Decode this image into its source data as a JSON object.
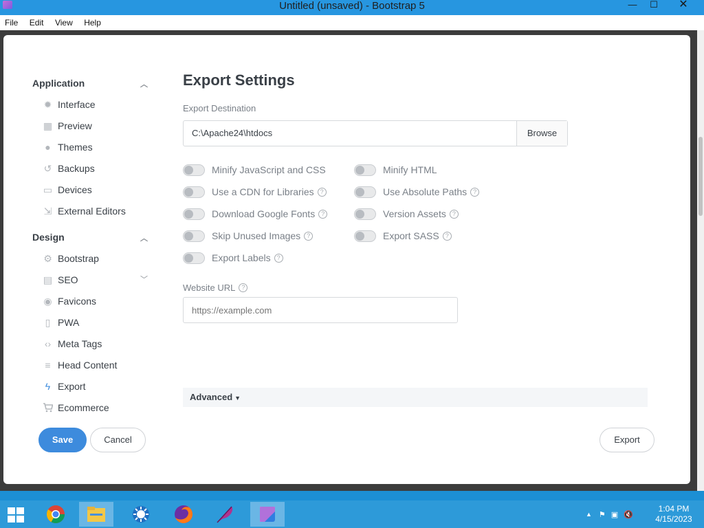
{
  "window": {
    "title": "Untitled (unsaved) - Bootstrap 5",
    "min_glyph": "—",
    "max_glyph": "☐",
    "close_glyph": "✕"
  },
  "menu": [
    "File",
    "Edit",
    "View",
    "Help"
  ],
  "sidebar": {
    "sections": [
      {
        "title": "Application",
        "items": [
          {
            "label": "Interface",
            "icon": "sun-icon",
            "glyph": "✹"
          },
          {
            "label": "Preview",
            "icon": "film-icon",
            "glyph": "▦"
          },
          {
            "label": "Themes",
            "icon": "palette-icon",
            "glyph": "●"
          },
          {
            "label": "Backups",
            "icon": "history-icon",
            "glyph": "↺"
          },
          {
            "label": "Devices",
            "icon": "laptop-icon",
            "glyph": "▭"
          },
          {
            "label": "External Editors",
            "icon": "external-link-icon",
            "glyph": "⇲"
          }
        ]
      },
      {
        "title": "Design",
        "items": [
          {
            "label": "Bootstrap",
            "icon": "gear-icon",
            "glyph": "⚙"
          },
          {
            "label": "SEO",
            "icon": "chart-icon",
            "glyph": "▤"
          },
          {
            "label": "Favicons",
            "icon": "circle-icon",
            "glyph": "◉"
          },
          {
            "label": "PWA",
            "icon": "phone-icon",
            "glyph": "▯"
          },
          {
            "label": "Meta Tags",
            "icon": "code-icon",
            "glyph": "‹›"
          },
          {
            "label": "Head Content",
            "icon": "lines-icon",
            "glyph": "≡"
          },
          {
            "label": "Export",
            "icon": "lightning-icon",
            "glyph": "ϟ"
          },
          {
            "label": "Ecommerce",
            "icon": "cart-icon",
            "glyph": "🛒"
          }
        ]
      }
    ]
  },
  "main": {
    "title": "Export Settings",
    "export_destination_label": "Export Destination",
    "export_destination_value": "C:\\Apache24\\htdocs",
    "browse_label": "Browse",
    "toggles": [
      {
        "label": "Minify JavaScript and CSS",
        "help": false,
        "on": false
      },
      {
        "label": "Minify HTML",
        "help": false,
        "on": false
      },
      {
        "label": "Use a CDN for Libraries",
        "help": true,
        "on": false
      },
      {
        "label": "Use Absolute Paths",
        "help": true,
        "on": false
      },
      {
        "label": "Download Google Fonts",
        "help": true,
        "on": false
      },
      {
        "label": "Version Assets",
        "help": true,
        "on": false
      },
      {
        "label": "Skip Unused Images",
        "help": true,
        "on": false
      },
      {
        "label": "Export SASS",
        "help": true,
        "on": false
      },
      {
        "label": "Export Labels",
        "help": true,
        "on": false
      }
    ],
    "website_url_label": "Website URL",
    "website_url_placeholder": "https://example.com",
    "advanced_label": "Advanced",
    "help_glyph": "?"
  },
  "buttons": {
    "save": "Save",
    "cancel": "Cancel",
    "export": "Export"
  },
  "taskbar": {
    "items": [
      "chrome-icon",
      "file-explorer-icon",
      "settings-icon",
      "firefox-icon",
      "feather-icon",
      "bootstrap-studio-icon"
    ],
    "time": "1:04 PM",
    "date": "4/15/2023",
    "tray_up_glyph": "▲"
  },
  "colors": {
    "accent": "#3d8bdd",
    "titlebar": "#2796e0",
    "taskbar": "#2d9ad9"
  }
}
